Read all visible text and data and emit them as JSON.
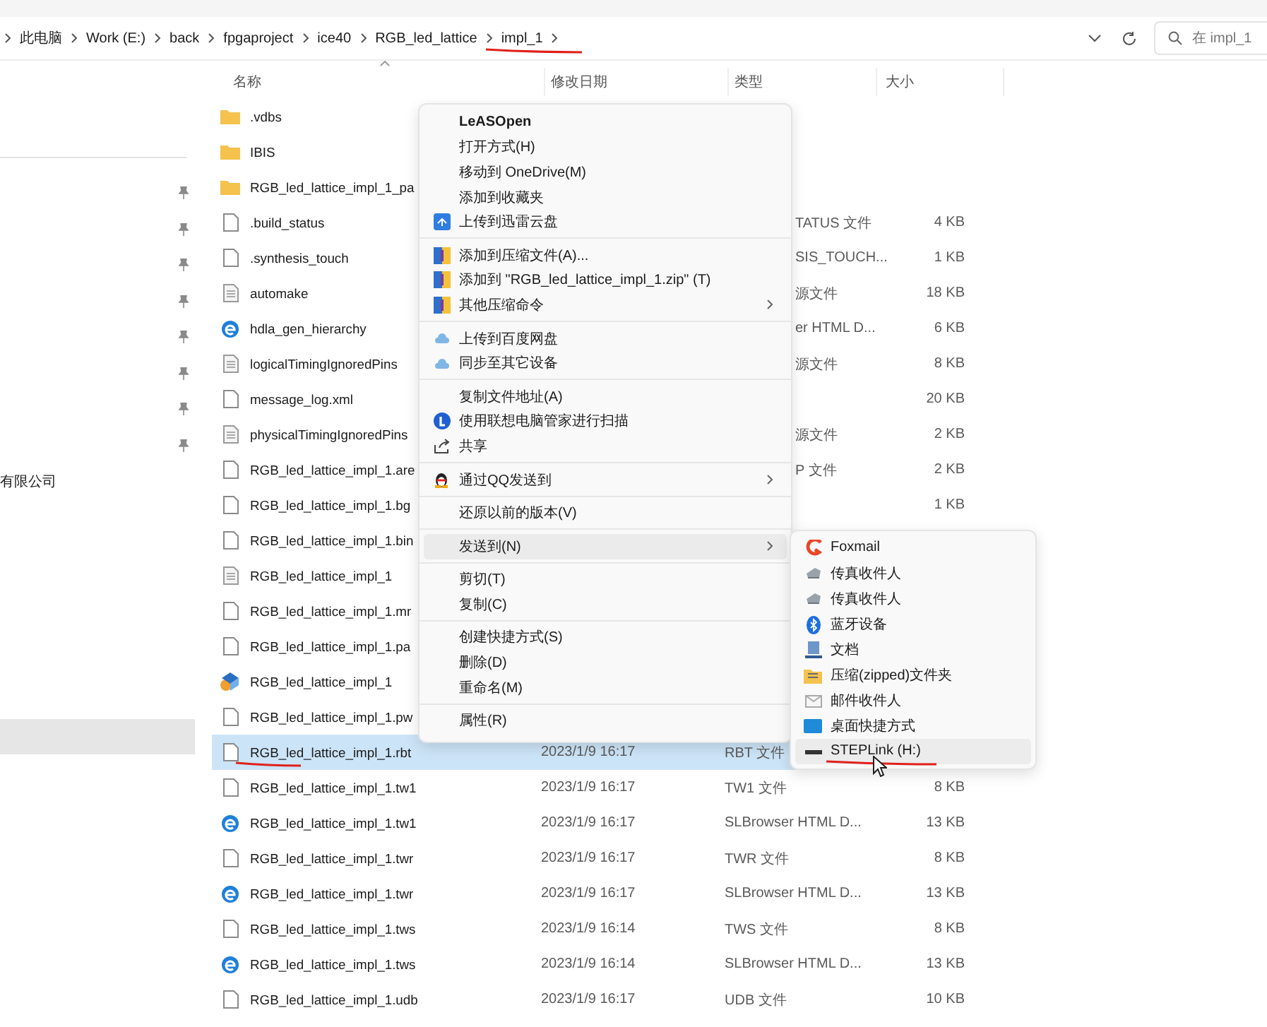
{
  "address_bar": {
    "path": [
      {
        "label": "此电脑",
        "underlined": false
      },
      {
        "label": "Work (E:)",
        "underlined": false
      },
      {
        "label": "back",
        "underlined": false
      },
      {
        "label": "fpgaproject",
        "underlined": false
      },
      {
        "label": "ice40",
        "underlined": false
      },
      {
        "label": "RGB_led_lattice",
        "underlined": false
      },
      {
        "label": "impl_1",
        "underlined": true
      }
    ],
    "search": {
      "placeholder": "在 impl_1"
    }
  },
  "sidebar": {
    "items": [
      {
        "pinned": true,
        "selected": false
      },
      {
        "pinned": true,
        "selected": false
      },
      {
        "pinned": true,
        "selected": false
      },
      {
        "pinned": true,
        "selected": false
      },
      {
        "pinned": true,
        "selected": false
      },
      {
        "pinned": true,
        "selected": false
      },
      {
        "pinned": true,
        "selected": false
      },
      {
        "pinned": true,
        "selected": false
      },
      {
        "label": "有限公司",
        "pinned": false,
        "selected": false
      },
      {
        "pinned": false,
        "selected": true
      }
    ]
  },
  "file_list": {
    "columns": [
      "名称",
      "修改日期",
      "类型",
      "大小"
    ],
    "rows": [
      {
        "kind": "folder",
        "name": ".vdbs",
        "selected": false,
        "underlined": false
      },
      {
        "kind": "folder",
        "name": "IBIS",
        "selected": false,
        "underlined": false
      },
      {
        "kind": "folder",
        "name": "RGB_led_lattice_impl_1_pa",
        "selected": false,
        "underlined": false
      },
      {
        "kind": "file",
        "name": ".build_status",
        "type": "TATUS 文件",
        "partly_hidden": true,
        "size": "4 KB",
        "selected": false,
        "underlined": false
      },
      {
        "kind": "file",
        "name": ".synthesis_touch",
        "type": "SIS_TOUCH...",
        "partly_hidden": true,
        "size": "1 KB",
        "selected": false,
        "underlined": false
      },
      {
        "kind": "text",
        "name": "automake",
        "type": "源文件",
        "partly_hidden": true,
        "size": "18 KB",
        "selected": false,
        "underlined": false
      },
      {
        "kind": "browser",
        "name": "hdla_gen_hierarchy",
        "type": "er HTML D...",
        "partly_hidden": true,
        "size": "6 KB",
        "selected": false,
        "underlined": false
      },
      {
        "kind": "text",
        "name": "logicalTimingIgnoredPins",
        "type": "源文件",
        "partly_hidden": true,
        "size": "8 KB",
        "selected": false,
        "underlined": false
      },
      {
        "kind": "file",
        "name": "message_log.xml",
        "size": "20 KB",
        "selected": false,
        "underlined": false
      },
      {
        "kind": "text",
        "name": "physicalTimingIgnoredPins",
        "type": "源文件",
        "partly_hidden": true,
        "size": "2 KB",
        "selected": false,
        "underlined": false
      },
      {
        "kind": "file",
        "name": "RGB_led_lattice_impl_1.are",
        "type": "P 文件",
        "partly_hidden": true,
        "size": "2 KB",
        "selected": false,
        "underlined": false
      },
      {
        "kind": "file",
        "name": "RGB_led_lattice_impl_1.bg",
        "size": "1 KB",
        "selected": false,
        "underlined": false
      },
      {
        "kind": "file",
        "name": "RGB_led_lattice_impl_1.bin",
        "selected": false,
        "underlined": false
      },
      {
        "kind": "text",
        "name": "RGB_led_lattice_impl_1",
        "selected": false,
        "underlined": false
      },
      {
        "kind": "file",
        "name": "RGB_led_lattice_impl_1.mr",
        "selected": false,
        "underlined": false
      },
      {
        "kind": "file",
        "name": "RGB_led_lattice_impl_1.pa",
        "selected": false,
        "underlined": false
      },
      {
        "kind": "app",
        "name": "RGB_led_lattice_impl_1",
        "selected": false,
        "underlined": false
      },
      {
        "kind": "file",
        "name": "RGB_led_lattice_impl_1.pw",
        "selected": false,
        "underlined": false
      },
      {
        "kind": "file",
        "name": "RGB_led_lattice_impl_1.rbt",
        "date": "2023/1/9 16:17",
        "type": "RBT 文件",
        "selected": true,
        "underlined": true
      },
      {
        "kind": "file",
        "name": "RGB_led_lattice_impl_1.tw1",
        "date": "2023/1/9 16:17",
        "type": "TW1 文件",
        "size": "8 KB",
        "selected": false,
        "underlined": false
      },
      {
        "kind": "browser",
        "name": "RGB_led_lattice_impl_1.tw1",
        "date": "2023/1/9 16:17",
        "type": "SLBrowser HTML D...",
        "size": "13 KB",
        "selected": false,
        "underlined": false
      },
      {
        "kind": "file",
        "name": "RGB_led_lattice_impl_1.twr",
        "date": "2023/1/9 16:17",
        "type": "TWR 文件",
        "size": "8 KB",
        "selected": false,
        "underlined": false
      },
      {
        "kind": "browser",
        "name": "RGB_led_lattice_impl_1.twr",
        "date": "2023/1/9 16:17",
        "type": "SLBrowser HTML D...",
        "size": "13 KB",
        "selected": false,
        "underlined": false
      },
      {
        "kind": "file",
        "name": "RGB_led_lattice_impl_1.tws",
        "date": "2023/1/9 16:14",
        "type": "TWS 文件",
        "size": "8 KB",
        "selected": false,
        "underlined": false
      },
      {
        "kind": "browser",
        "name": "RGB_led_lattice_impl_1.tws",
        "date": "2023/1/9 16:14",
        "type": "SLBrowser HTML D...",
        "size": "13 KB",
        "selected": false,
        "underlined": false
      },
      {
        "kind": "file",
        "name": "RGB_led_lattice_impl_1.udb",
        "date": "2023/1/9 16:17",
        "type": "UDB 文件",
        "size": "10 KB",
        "selected": false,
        "underlined": false
      }
    ]
  },
  "context_menu": {
    "items": [
      {
        "kind": "item",
        "label": "LeASOpen",
        "default": true,
        "selected": false
      },
      {
        "kind": "item",
        "label": "打开方式(H)",
        "selected": false
      },
      {
        "kind": "item",
        "label": "移动到 OneDrive(M)",
        "selected": false
      },
      {
        "kind": "item",
        "label": "添加到收藏夹",
        "selected": false
      },
      {
        "kind": "item",
        "label": "上传到迅雷云盘",
        "selected": false
      },
      {
        "kind": "separator"
      },
      {
        "kind": "item",
        "label": "添加到压缩文件(A)...",
        "selected": false
      },
      {
        "kind": "item",
        "label": "添加到 \"RGB_led_lattice_impl_1.zip\" (T)",
        "selected": false
      },
      {
        "kind": "item",
        "label": "其他压缩命令",
        "has_submenu": true,
        "selected": false
      },
      {
        "kind": "separator"
      },
      {
        "kind": "item",
        "label": "上传到百度网盘",
        "selected": false
      },
      {
        "kind": "item",
        "label": "同步至其它设备",
        "selected": false
      },
      {
        "kind": "separator"
      },
      {
        "kind": "item",
        "label": "复制文件地址(A)",
        "selected": false
      },
      {
        "kind": "item",
        "label": "使用联想电脑管家进行扫描",
        "selected": false
      },
      {
        "kind": "item",
        "label": "共享",
        "selected": false
      },
      {
        "kind": "separator"
      },
      {
        "kind": "item",
        "label": "通过QQ发送到",
        "has_submenu": true,
        "selected": false
      },
      {
        "kind": "separator"
      },
      {
        "kind": "item",
        "label": "还原以前的版本(V)",
        "selected": false
      },
      {
        "kind": "separator"
      },
      {
        "kind": "item",
        "label": "发送到(N)",
        "has_submenu": true,
        "selected": true,
        "submenu": [
          {
            "label": "Foxmail",
            "selected": false,
            "underlined": false
          },
          {
            "label": "传真收件人",
            "selected": false,
            "underlined": false
          },
          {
            "label": "传真收件人",
            "selected": false,
            "underlined": false
          },
          {
            "label": "蓝牙设备",
            "selected": false,
            "underlined": false
          },
          {
            "label": "文档",
            "selected": false,
            "underlined": false
          },
          {
            "label": "压缩(zipped)文件夹",
            "selected": false,
            "underlined": false
          },
          {
            "label": "邮件收件人",
            "selected": false,
            "underlined": false
          },
          {
            "label": "桌面快捷方式",
            "selected": false,
            "underlined": false
          },
          {
            "label": "STEPLink (H:)",
            "selected": true,
            "underlined": true
          }
        ]
      },
      {
        "kind": "separator"
      },
      {
        "kind": "item",
        "label": "剪切(T)",
        "selected": false
      },
      {
        "kind": "item",
        "label": "复制(C)",
        "selected": false
      },
      {
        "kind": "separator"
      },
      {
        "kind": "item",
        "label": "创建快捷方式(S)",
        "selected": false
      },
      {
        "kind": "item",
        "label": "删除(D)",
        "selected": false
      },
      {
        "kind": "item",
        "label": "重命名(M)",
        "selected": false
      },
      {
        "kind": "separator"
      },
      {
        "kind": "item",
        "label": "属性(R)",
        "selected": false
      }
    ]
  }
}
